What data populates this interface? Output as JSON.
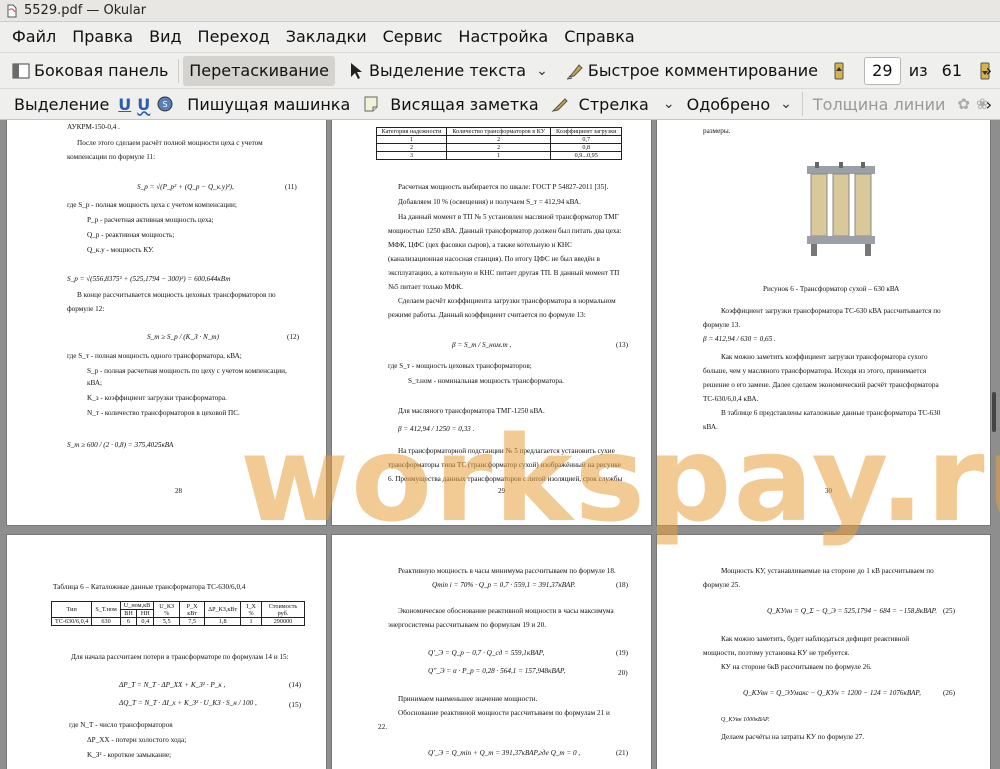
{
  "window": {
    "title": "5529.pdf  — Okular"
  },
  "menu": [
    "Файл",
    "Правка",
    "Вид",
    "Переход",
    "Закладки",
    "Сервис",
    "Настройка",
    "Справка"
  ],
  "toolbar1": {
    "sidebar": "Боковая панель",
    "drag": "Перетаскивание",
    "text_select": "Выделение текста",
    "quick_comment": "Быстрое комментирование",
    "page_current": "29",
    "of": "из",
    "page_total": "61"
  },
  "toolbar2": {
    "select": "Выделение",
    "typewriter": "Пишущая машинка",
    "sticky": "Висящая заметка",
    "arrow": "Стрелка",
    "approved": "Одобрено",
    "line_width": "Толщина линии"
  },
  "watermark": "workspay.ru",
  "pages": {
    "p28": {
      "number": "28",
      "lines": [
        "АУКРМ-150-0,4 .",
        "После этого сделаем расчёт полной мощности цеха с учетом",
        "компенсации по формуле 11:",
        "S_р = √(P_р² + (Q_р − Q_к.у)²),",
        "(11)",
        "где  S_р - полная мощность цеха с учетом компенсации;",
        "P_р - расчетная активная мощность цеха;",
        "Q_р - реактивная мощность;",
        "Q_к.у - мощность КУ.",
        "S_р = √(556,8375² + (525,1794 − 300)²) = 600,644кВт",
        "В конце рассчитывается мощность цеховых трансформаторов по",
        "формуле 12:",
        "S_т ≥ S_р / (K_З · N_т)",
        "(12)",
        "где  S_т - полная мощность одного трансформатора, кВА;",
        "S_р - полная расчетная мощность по цеху с учетом компенсации,",
        "кВА;",
        "K_з - коэффициент загрузки трансформатора.",
        "N_т - количество трансформаторов в цеховой ПС.",
        "S_т ≥ 600 / (2 · 0,8) = 375,4025кВА"
      ]
    },
    "p29": {
      "number": "29",
      "table_head": [
        "Категория надежности",
        "Количество трансформаторов в КУ",
        "Коэффициент загрузки"
      ],
      "table_rows": [
        [
          "1",
          "2",
          "0,7"
        ],
        [
          "2",
          "2",
          "0,8"
        ],
        [
          "3",
          "1",
          "0,9...0,95"
        ]
      ],
      "lines": [
        "Расчетная мощность выбирается по шкале: ГОСТ Р 54827-2011 [35].",
        "Добавляем 10 % (освещения) и получаем  S_т = 412,94 кВА.",
        "На данный момент в ТП № 5 установлен масляной трансформатор ТМГ",
        "мощностью 1250 кВА. Данный трансформатор должен был питать два цеха:",
        "МФК, ЦФС (цех фасовки сыров), а также котельную и КНС",
        "(канализационная насосная станция). По итогу ЦФС не был введён в",
        "эксплуатацию, а котельную и КНС питает другая ТП. В данный момент ТП",
        "№5 питает только МФК.",
        "Сделаем расчёт коэффициента загрузки трансформатора в нормальном",
        "режиме работы. Данный коэффициент считается по формуле 13:",
        "β = S_т / S_ном.т ,",
        "(13)",
        "где  S_т - мощность цеховых трансформаторов;",
        "S_т.ном - номинальная мощность трансформатора.",
        "Для масляного трансформатора ТМГ-1250 кВА.",
        "β = 412,94 / 1250 = 0,33 .",
        "На трансформаторной подстанции № 5 предлагается установить сухие",
        "трансформаторы типа ТС (трансформатор сухой) изображённый на рисунке",
        "6. Преимущества данных трансформаторов с литой изоляцией, срок службы"
      ]
    },
    "p30": {
      "number": "30",
      "lines": [
        "размеры.",
        "Рисунок 6 - Трансформатор сухой – 630 кВА",
        "Коэффициент загрузки трансформатора ТС-630 кВА рассчитывается по",
        "формуле 13.",
        "β = 412,94 / 630 = 0,65 .",
        "Как можно заметить коэффициент загрузки трансформатора сухого",
        "больше, чем у масляного трансформатора. Исходя из этого, принимается",
        "решение о его замене. Далее сделаем экономический расчёт трансформатора",
        "ТС-630/6,0,4 кВА.",
        "В таблице 6 представлены каталожные данные трансформатора ТС-630",
        "кВА."
      ]
    },
    "p31": {
      "lines": [
        "Таблица 6 – Каталожные данные трансформатора ТС-630/6,0,4",
        "Для начала рассчитаем потери в трансформаторе по формулам 14 и 15:",
        "ΔP_Т = N_Т · ΔP_ХХ + K_З² · P_к ,",
        "(14)",
        "ΔQ_Т = N_Т · ΔI_х + K_З² · U_КЗ · S_н / 100 ,",
        "(15)",
        "где  N_Т - число трансформаторов",
        "ΔP_ХХ - потери холостого хода;",
        "K_З² - короткое замыкание;"
      ],
      "table_head": [
        "Тип",
        "S_Т.ном",
        "U_ном,кВ",
        "U_КЗ %",
        "P_Х кВт",
        "ΔP_КЗ,кВт",
        "I_Х %",
        "Стоимость руб."
      ],
      "table_sub": [
        "ВН",
        "НН"
      ],
      "table_row": [
        "ТС-630/6,0,4",
        "630",
        "6",
        "0,4",
        "5,5",
        "7,5",
        "1,8",
        "1",
        "290000"
      ]
    },
    "p32": {
      "lines": [
        "Реактивную мощность в часы минимума рассчитываем по формуле 18.",
        "Qmin i = 70% · Q_р = 0,7 · 559,1 = 391,37кВАР.",
        "(18)",
        "Экономическое обоснование реактивной мощности в часы максимума",
        "энергосистемы рассчитываем по формулам 19 и 20.",
        "Q'_Э = Q_р − 0,7 · Q_сд = 559,1кВАР,",
        "(19)",
        "Q''_Э = α · P_р = 0,28 · 564,1 = 157,948кВАР,",
        "20)",
        "Принимаем наименьшее значение мощности.",
        "Обоснование реактивной мощности рассчитываем по формулам 21 и",
        "22.",
        "Q'_Э = Q_min + Q_т = 391,37кВАР,где Q_т = 0 ,",
        "(21)"
      ]
    },
    "p33": {
      "lines": [
        "Мощность КУ, устанавливаемые на стороне до 1 кВ рассчитываем по",
        "формуле 25.",
        "Q_КУнн = Q_Σ − Q_Э = 525,1794 − 684 = −158,8кВАР.",
        "(25)",
        "Как можно заметить, будет наблюдаться дефицит реактивной",
        "мощности, поэтому установка КУ не требуется.",
        "КУ на стороне 6кВ рассчитываем по формуле 26.",
        "Q_КУвн = Q_ЭУмакс − Q_КУн = 1200 − 124 = 1076кВАР,",
        "(26)",
        "Q_КУвн 1000кВАР.",
        "Делаем расчёты на затраты КУ по формуле 27."
      ]
    }
  }
}
